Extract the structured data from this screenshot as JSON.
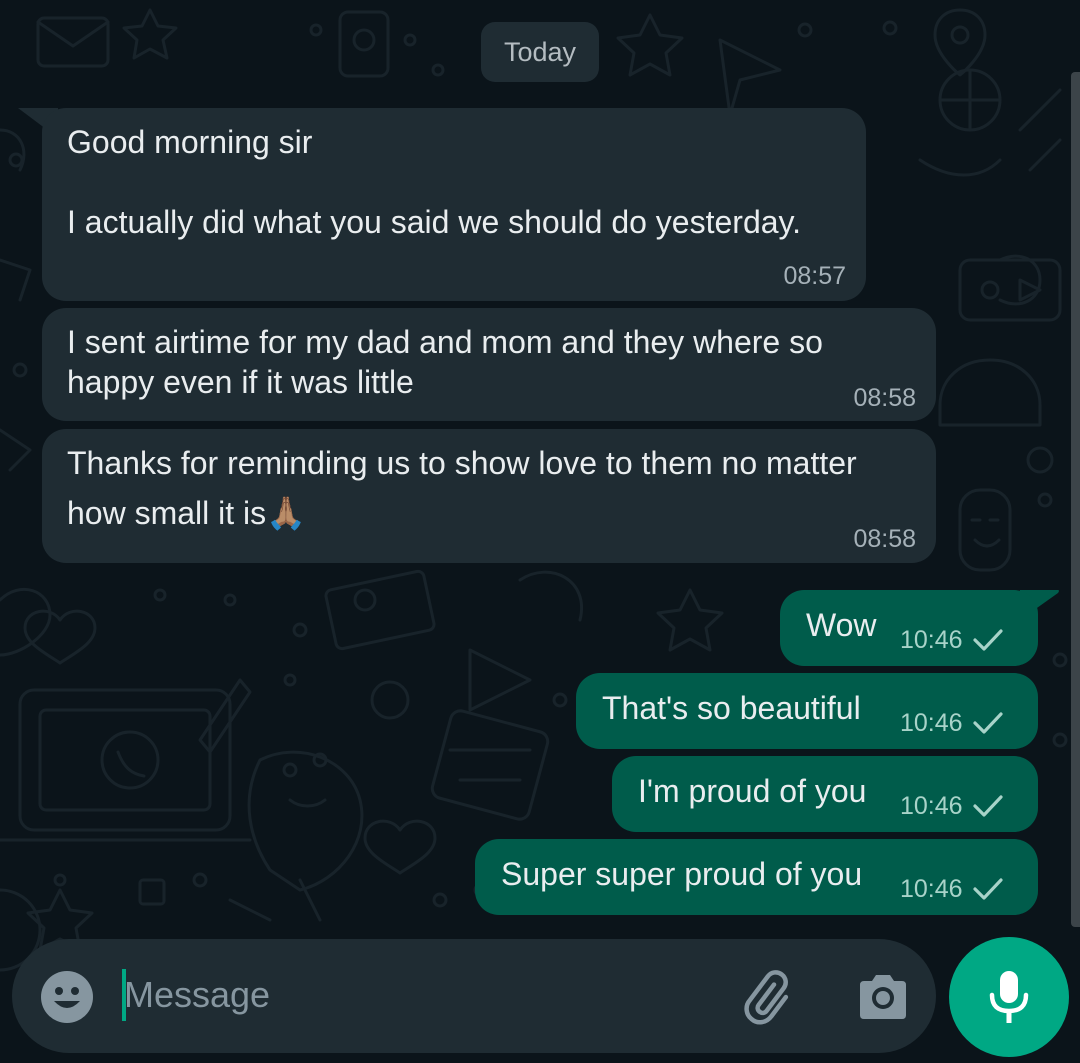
{
  "date_chip": "Today",
  "messages": [
    {
      "direction": "incoming",
      "lines": [
        "Good morning sir",
        "",
        "I actually did what you said we should do yesterday."
      ],
      "time": "08:57"
    },
    {
      "direction": "incoming",
      "lines": [
        "I sent airtime for my dad and mom and they where so",
        "happy even if it was little"
      ],
      "time": "08:58"
    },
    {
      "direction": "incoming",
      "lines": [
        "Thanks for reminding us to show love to them no matter",
        "how small it is🙏🏽"
      ],
      "time": "08:58"
    },
    {
      "direction": "outgoing",
      "text": "Wow",
      "time": "10:46",
      "status": "sent"
    },
    {
      "direction": "outgoing",
      "text": "That's so beautiful",
      "time": "10:46",
      "status": "sent"
    },
    {
      "direction": "outgoing",
      "text": "I'm proud of you",
      "time": "10:46",
      "status": "sent"
    },
    {
      "direction": "outgoing",
      "text": "Super super proud of you",
      "time": "10:46",
      "status": "sent"
    }
  ],
  "composer": {
    "placeholder": "Message",
    "value": "",
    "emoji_icon": "emoji-icon",
    "attach_icon": "paperclip-icon",
    "camera_icon": "camera-icon",
    "send_icon": "microphone-icon"
  },
  "colors": {
    "background": "#0b141a",
    "incoming_bubble": "#1f2c33",
    "outgoing_bubble": "#005c4b",
    "accent": "#00a884",
    "text": "#e9edef",
    "meta_text": "#8696a0"
  }
}
